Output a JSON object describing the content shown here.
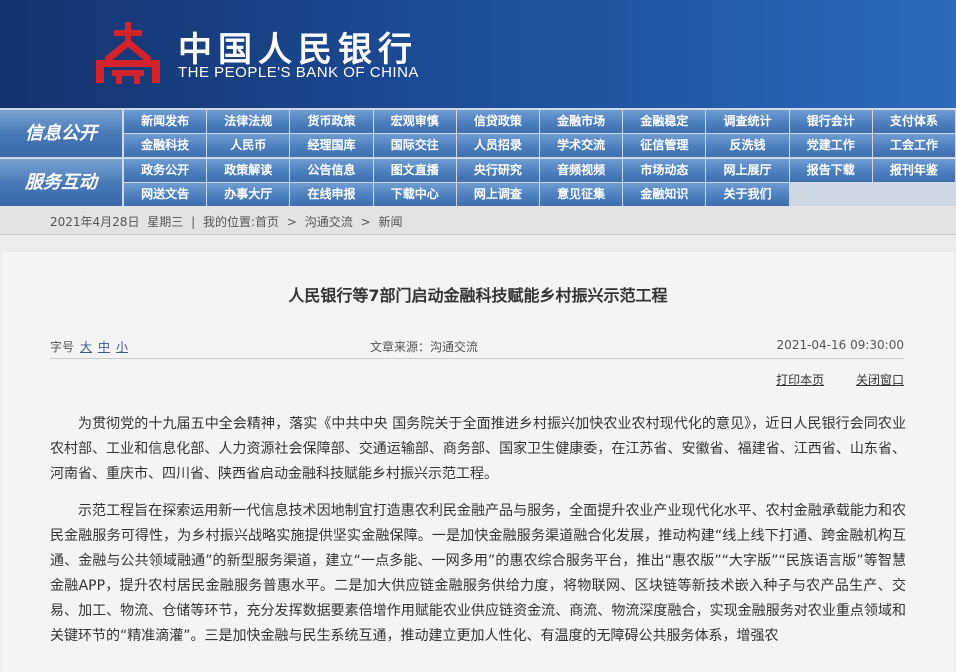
{
  "brand": {
    "name_cn": "中国人民银行",
    "name_en": "THE PEOPLE'S BANK OF CHINA"
  },
  "nav": {
    "sections": [
      {
        "label": "信息公开",
        "rows": [
          [
            "新闻发布",
            "法律法规",
            "货币政策",
            "宏观审慎",
            "信贷政策",
            "金融市场",
            "金融稳定",
            "调查统计",
            "银行会计",
            "支付体系"
          ],
          [
            "金融科技",
            "人民币",
            "经理国库",
            "国际交往",
            "人员招录",
            "学术交流",
            "征信管理",
            "反洗钱",
            "党建工作",
            "工会工作"
          ]
        ]
      },
      {
        "label": "服务互动",
        "rows": [
          [
            "政务公开",
            "政策解读",
            "公告信息",
            "图文直播",
            "央行研究",
            "音频视频",
            "市场动态",
            "网上展厅",
            "报告下载",
            "报刊年鉴"
          ],
          [
            "网送文告",
            "办事大厅",
            "在线申报",
            "下载中心",
            "网上调查",
            "意见征集",
            "金融知识",
            "关于我们",
            "",
            ""
          ]
        ]
      }
    ]
  },
  "breadcrumb": {
    "date": "2021年4月28日",
    "weekday": "星期三",
    "sep": "|",
    "prefix": "我的位置:",
    "items": [
      "首页",
      "沟通交流",
      "新闻"
    ],
    "arrow": ">"
  },
  "article": {
    "title": "人民银行等7部门启动金融科技赋能乡村振兴示范工程",
    "font_label": "字号",
    "font_options": [
      "大",
      "中",
      "小"
    ],
    "source": "文章来源：沟通交流",
    "datetime": "2021-04-16 09:30:00",
    "print": "打印本页",
    "close": "关闭窗口",
    "paragraphs": [
      "为贯彻党的十九届五中全会精神，落实《中共中央 国务院关于全面推进乡村振兴加快农业农村现代化的意见》，近日人民银行会同农业农村部、工业和信息化部、人力资源社会保障部、交通运输部、商务部、国家卫生健康委，在江苏省、安徽省、福建省、江西省、山东省、河南省、重庆市、四川省、陕西省启动金融科技赋能乡村振兴示范工程。",
      "示范工程旨在探索运用新一代信息技术因地制宜打造惠农利民金融产品与服务，全面提升农业产业现代化水平、农村金融承载能力和农民金融服务可得性，为乡村振兴战略实施提供坚实金融保障。一是加快金融服务渠道融合化发展，推动构建“线上线下打通、跨金融机构互通、金融与公共领域融通”的新型服务渠道，建立“一点多能、一网多用”的惠农综合服务平台，推出“惠农版”“大字版”“民族语言版”等智慧金融APP，提升农村居民金融服务普惠水平。二是加大供应链金融服务供给力度，将物联网、区块链等新技术嵌入种子与农产品生产、交易、加工、物流、仓储等环节，充分发挥数据要素倍增作用赋能农业供应链资金流、商流、物流深度融合，实现金融服务对农业重点领域和关键环节的“精准滴灌”。三是加快金融与民生系统互通，推动建立更加人性化、有温度的无障碍公共服务体系，增强农"
    ]
  },
  "colors": {
    "header_dark": "#16336f",
    "header_light": "#2b6ab9",
    "nav_item": "#4a7dbd",
    "logo_red": "#d4232b"
  }
}
